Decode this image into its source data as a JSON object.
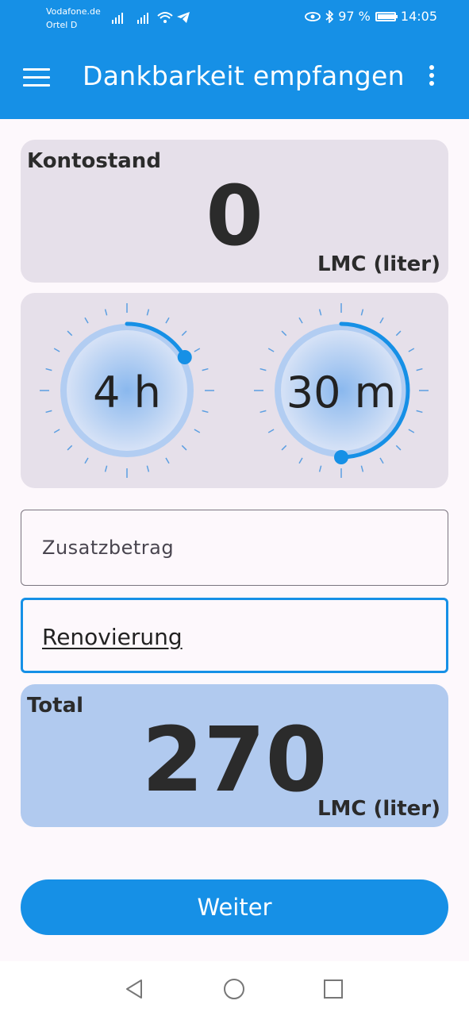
{
  "status_bar": {
    "carrier_line1": "Vodafone.de",
    "carrier_line2": "Ortel D",
    "battery_percent": "97 %",
    "battery_level": 0.97,
    "time": "14:05"
  },
  "app_bar": {
    "title": "Dankbarkeit empfangen",
    "menu_icon": "hamburger-menu-icon",
    "more_icon": "more-vertical-icon",
    "color": "#1690e6"
  },
  "balance": {
    "label": "Kontostand",
    "value": "0",
    "unit": "LMC (liter)"
  },
  "time_picker": {
    "hours": {
      "label": "4 h",
      "value": 4,
      "max": 24
    },
    "minutes": {
      "label": "30 m",
      "value": 30,
      "max": 60
    }
  },
  "amount_field": {
    "placeholder": "Zusatzbetrag"
  },
  "purpose_field": {
    "value": "Renovierung"
  },
  "total": {
    "label": "Total",
    "value": "270",
    "unit": "LMC (liter)"
  },
  "next_button": {
    "label": "Weiter"
  },
  "nav_bar": {
    "back_icon": "back-triangle-icon",
    "home_icon": "home-circle-icon",
    "recents_icon": "recents-square-icon"
  }
}
